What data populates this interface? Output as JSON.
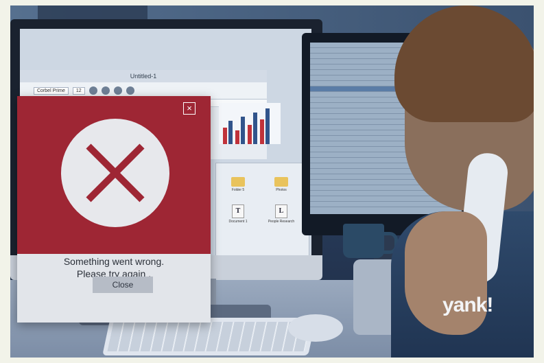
{
  "app_window": {
    "title": "Untitled-1",
    "font_name": "Corbel Prime",
    "font_size": "12"
  },
  "file_window": {
    "items": [
      "Folder 5",
      "Photos",
      "Document 1",
      "People Research"
    ]
  },
  "error_dialog": {
    "message_line1": "Something went wrong.",
    "message_line2": "Please try again .",
    "close_button": "Close",
    "close_icon": "×",
    "header_color": "#9e2634",
    "icon": "error-x-icon"
  },
  "watermark": {
    "text": "yank!"
  }
}
